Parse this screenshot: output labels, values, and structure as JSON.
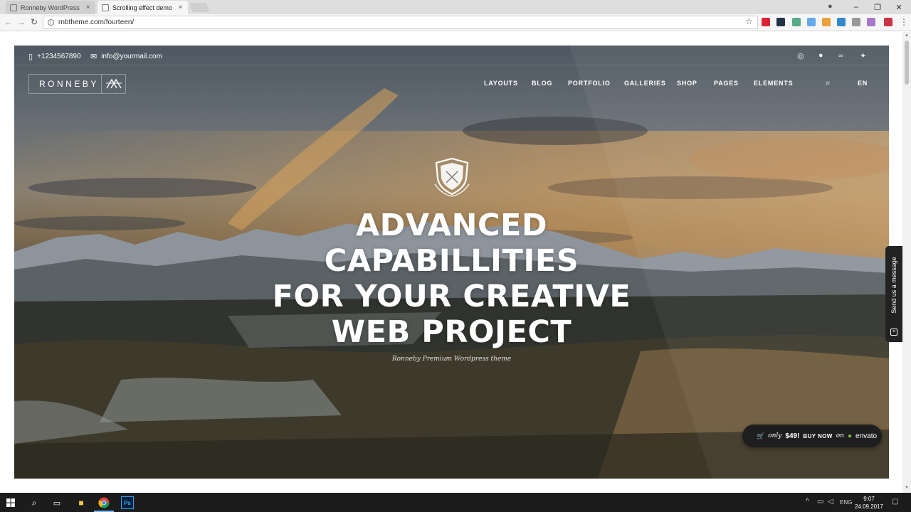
{
  "browser": {
    "tabs": [
      {
        "title": "Ronneby WordPress The",
        "active": false
      },
      {
        "title": "Scrolling effect demo",
        "active": true
      }
    ],
    "url": "rnbtheme.com/fourteen/"
  },
  "topbar": {
    "phone": "+1234567890",
    "email": "info@yourmail.com",
    "social_icons": [
      "dribbble-icon",
      "skype-icon",
      "lastfm-icon",
      "twitter-icon"
    ]
  },
  "site": {
    "logo_text": "RONNEBY",
    "nav": [
      "LAYOUTS",
      "BLOG",
      "PORTFOLIO",
      "GALLERIES",
      "SHOP",
      "PAGES",
      "ELEMENTS"
    ],
    "lang": "EN"
  },
  "hero": {
    "headline": [
      "ADVANCED",
      "CAPABILLITIES",
      "FOR YOUR CREATIVE",
      "WEB PROJECT"
    ],
    "tagline": "Ronneby Premium Wordpress theme"
  },
  "buy": {
    "only": "only",
    "price": "$49!",
    "buy_now": "BUY NOW",
    "on": "on",
    "brand": "envato"
  },
  "chat": {
    "label": "Send us a message"
  },
  "taskbar": {
    "lang": "ENG",
    "time": "9:07",
    "date": "24.09.2017"
  },
  "colors": {
    "envato_green": "#82b541",
    "taskbar": "#1c1c1c"
  }
}
